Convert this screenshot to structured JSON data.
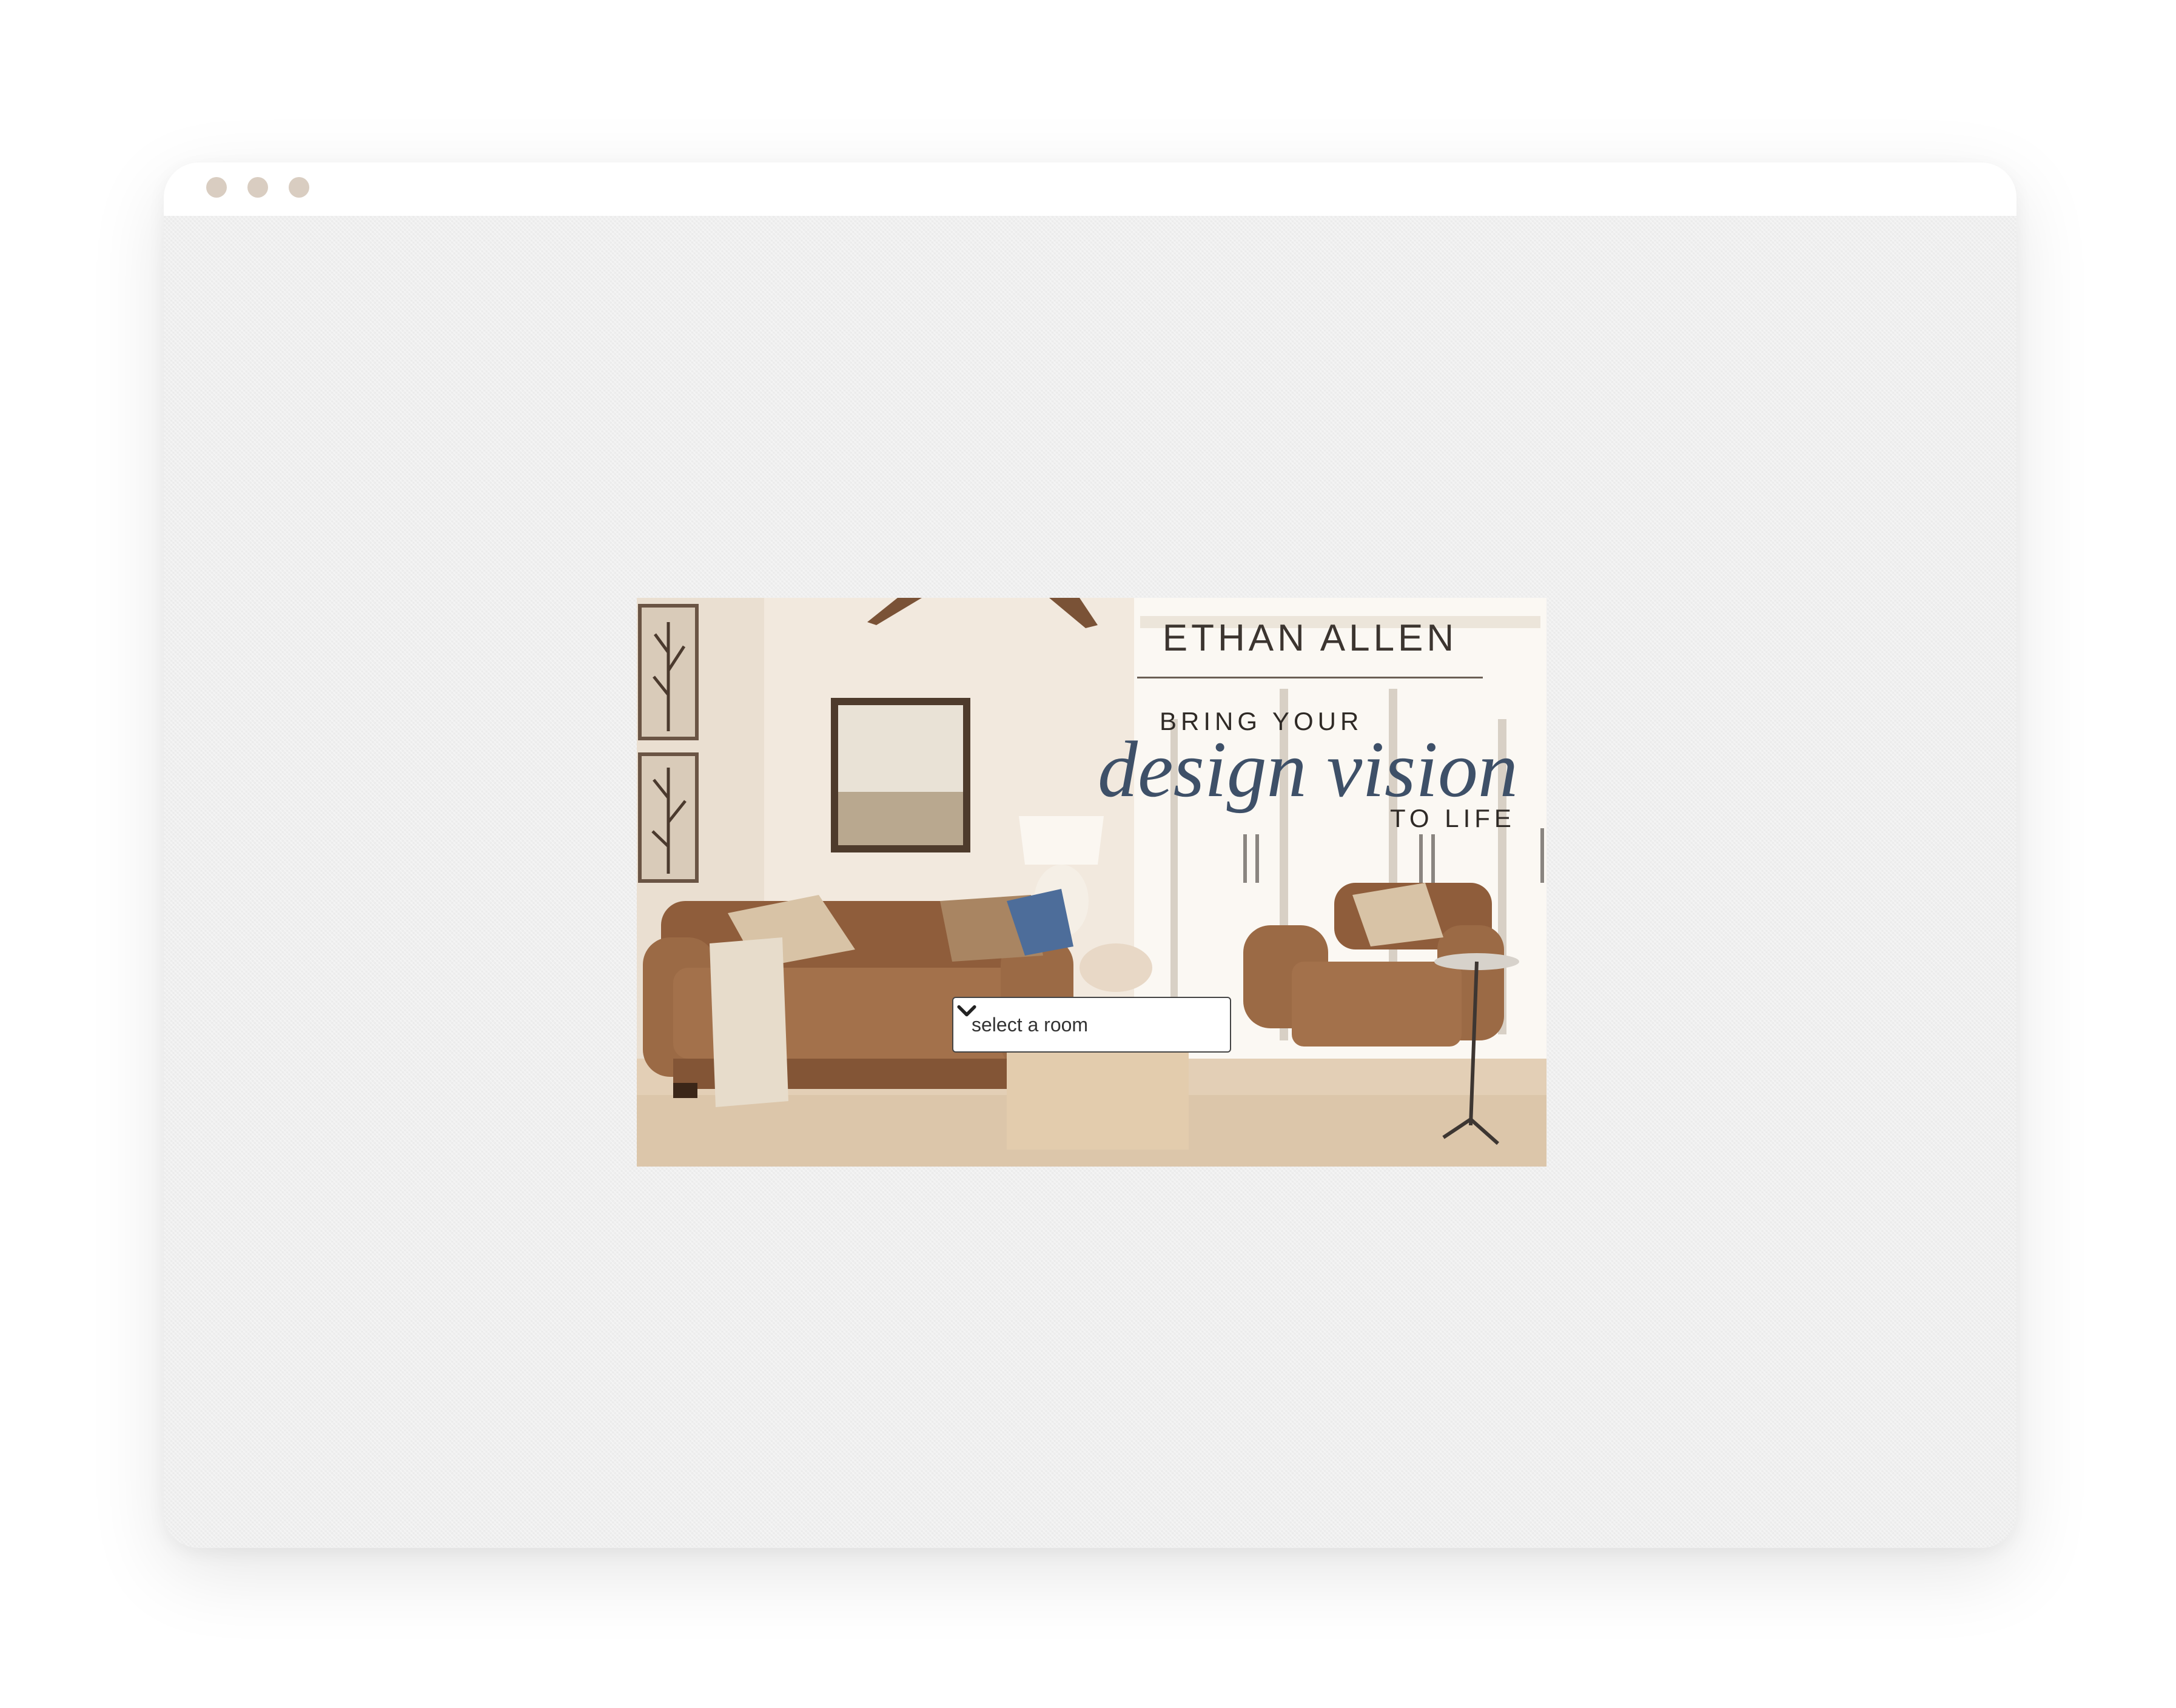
{
  "browser": {
    "window_controls": [
      "dot",
      "dot",
      "dot"
    ]
  },
  "hero": {
    "brand": "ETHAN ALLEN",
    "tagline_top": "BRING YOUR",
    "tagline_script": "design vision",
    "tagline_bottom": "TO LIFE",
    "room_select": {
      "label": "select a room",
      "icon": "chevron-down-icon"
    }
  },
  "colors": {
    "window_dot": "#d9cdc1",
    "script_accent": "#3e5068",
    "leather": "#9b6a45"
  }
}
